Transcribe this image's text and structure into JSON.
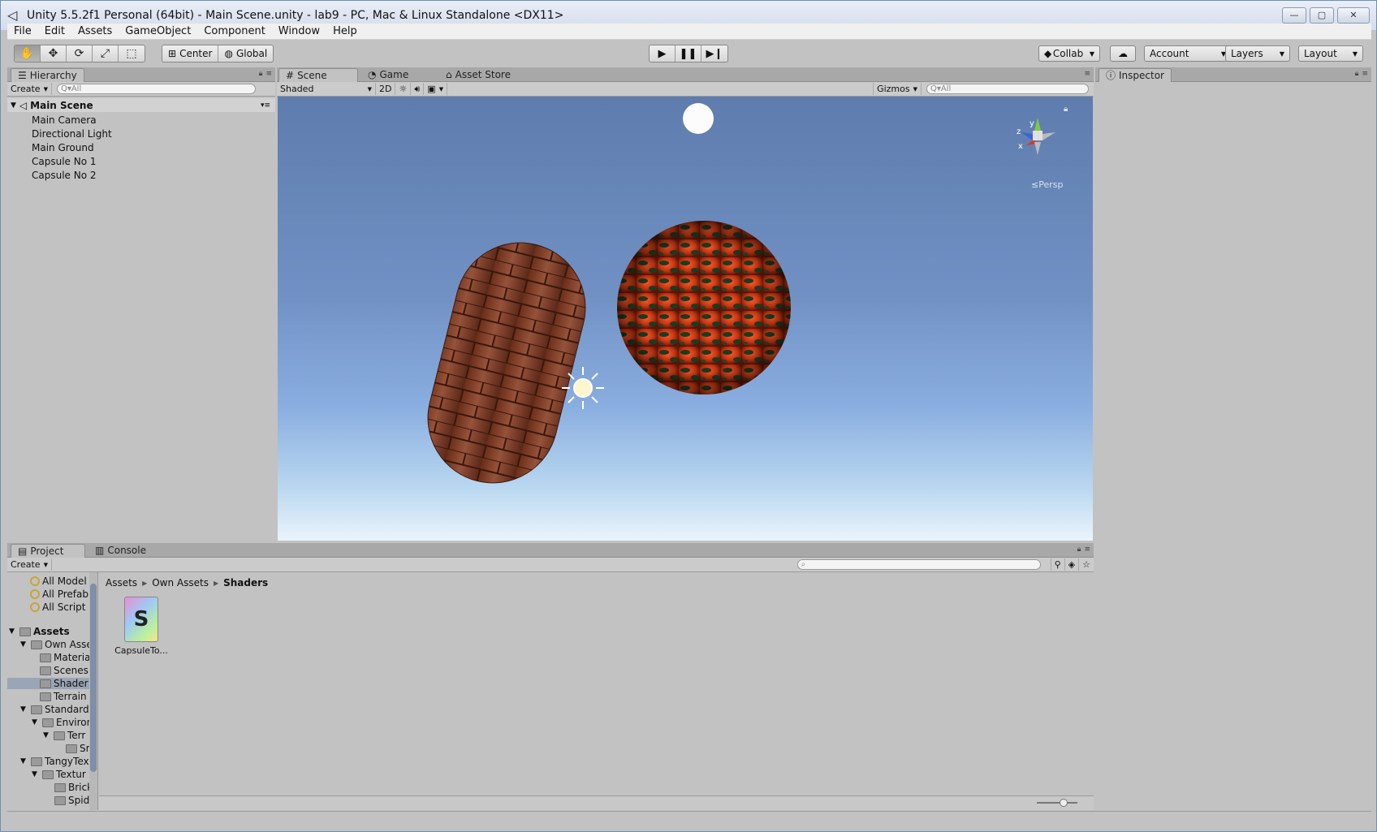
{
  "window": {
    "title": "Unity 5.5.2f1 Personal (64bit) - Main Scene.unity - lab9 - PC, Mac & Linux Standalone <DX11>"
  },
  "menu": [
    "File",
    "Edit",
    "Assets",
    "GameObject",
    "Component",
    "Window",
    "Help"
  ],
  "toolbar": {
    "pivot": "Center",
    "space": "Global",
    "collab": "Collab",
    "account": "Account",
    "layers": "Layers",
    "layout": "Layout"
  },
  "hierarchy": {
    "tab": "Hierarchy",
    "create": "Create",
    "search_placeholder": "Q▾All",
    "root": "Main Scene",
    "items": [
      "Main Camera",
      "Directional Light",
      "Main Ground",
      "Capsule No 1",
      "Capsule No 2"
    ]
  },
  "scene": {
    "tabs": [
      "Scene",
      "Game",
      "Asset Store"
    ],
    "shading": "Shaded",
    "mode2d": "2D",
    "gizmos": "Gizmos",
    "search_placeholder": "Q▾All",
    "persp": "Persp",
    "axes": {
      "x": "x",
      "y": "y",
      "z": "z"
    }
  },
  "inspector": {
    "tab": "Inspector"
  },
  "project": {
    "tabs": [
      "Project",
      "Console"
    ],
    "create": "Create",
    "favorites": [
      "All Model",
      "All Prefab",
      "All Script"
    ],
    "tree": [
      {
        "label": "Assets",
        "bold": true
      },
      {
        "label": "Own Asse"
      },
      {
        "label": "Materia"
      },
      {
        "label": "Scenes"
      },
      {
        "label": "Shader"
      },
      {
        "label": "Terrain"
      },
      {
        "label": "Standard"
      },
      {
        "label": "Environ"
      },
      {
        "label": "Terr"
      },
      {
        "label": "Sr"
      },
      {
        "label": "TangyTex"
      },
      {
        "label": "Textur"
      },
      {
        "label": "Brick"
      },
      {
        "label": "Spid"
      }
    ],
    "breadcrumb": [
      "Assets",
      "Own Assets",
      "Shaders"
    ],
    "asset": {
      "label": "CapsuleTo...",
      "glyph": "S"
    }
  }
}
